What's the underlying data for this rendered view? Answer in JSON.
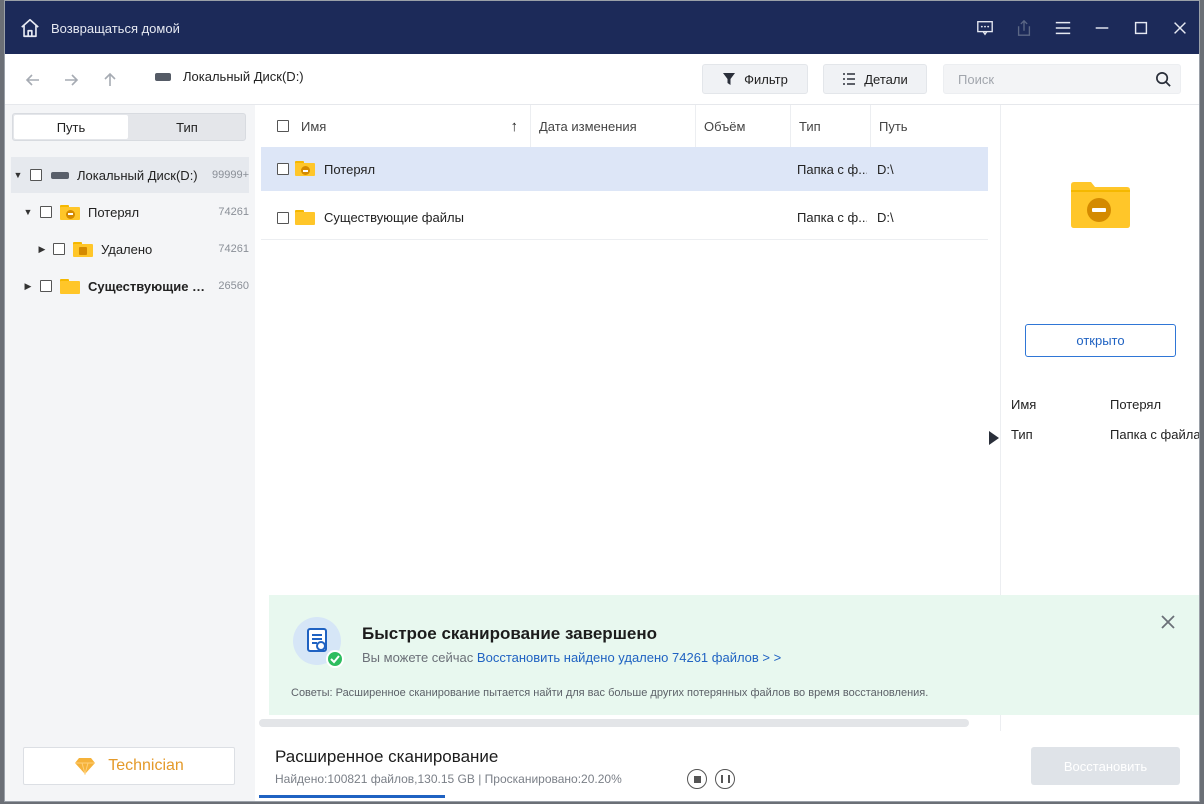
{
  "titlebar": {
    "home_label": "Возвращаться домой"
  },
  "toolbar": {
    "breadcrumb": "Локальный Диск(D:)",
    "filter_label": "Фильтр",
    "details_label": "Детали",
    "search_placeholder": "Поиск"
  },
  "sidebar": {
    "tabs": [
      "Путь",
      "Тип"
    ],
    "tree": [
      {
        "label": "Локальный Диск(D:)",
        "count": "99999+"
      },
      {
        "label": "Потерял",
        "count": "74261"
      },
      {
        "label": "Удалено",
        "count": "74261"
      },
      {
        "label": "Существующие фа...",
        "count": "26560"
      }
    ],
    "technician_label": "Technician"
  },
  "table": {
    "columns": [
      "Имя",
      "Дата изменения",
      "Объём",
      "Тип",
      "Путь"
    ],
    "rows": [
      {
        "name": "Потерял",
        "date": "",
        "size": "",
        "type": "Папка с ф...",
        "path": "D:\\"
      },
      {
        "name": "Существующие файлы",
        "date": "",
        "size": "",
        "type": "Папка с ф...",
        "path": "D:\\"
      }
    ]
  },
  "details": {
    "open_label": "открыто",
    "props": [
      {
        "key": "Имя",
        "value": "Потерял"
      },
      {
        "key": "Тип",
        "value": "Папка с файла..."
      }
    ]
  },
  "notice": {
    "title": "Быстрое сканирование завершено",
    "sub_prefix": "Вы можете сейчас",
    "sub_link": "Восстановить найдено удалено 74261 файлов > >",
    "tip": "Советы: Расширенное сканирование пытается найти для вас больше других потерянных файлов во время восстановления."
  },
  "bottom": {
    "scan_title": "Расширенное сканирование",
    "scan_stats": "Найдено:100821 файлов,130.15 GB | Просканировано:20.20%",
    "progress": 0.202,
    "restore_label": "Восстановить"
  },
  "colors": {
    "titlebar": "#1c2a59",
    "accent": "#1f62c2",
    "folder": "#ffc629",
    "notice_bg": "#e8f8ef",
    "success": "#2ebd5f"
  }
}
